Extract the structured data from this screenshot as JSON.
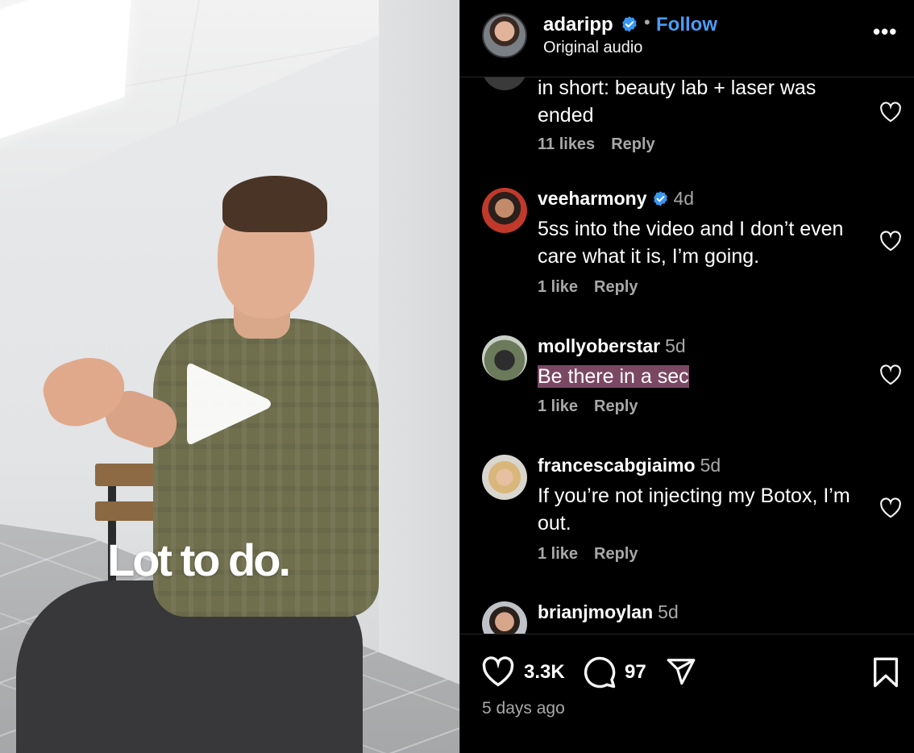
{
  "video": {
    "caption": "Lot to do.",
    "play_icon": "play-icon"
  },
  "header": {
    "username": "adaripp",
    "verified": true,
    "separator": "•",
    "follow_label": "Follow",
    "audio": "Original audio",
    "more_icon": "more-icon",
    "more_label": "•••"
  },
  "comments": [
    {
      "username": "",
      "time": "",
      "text": "in short: beauty lab + laser was ended",
      "likes": "11 likes",
      "reply": "Reply"
    },
    {
      "username": "veeharmony",
      "verified": true,
      "time": "4d",
      "text": "5ss into the video and I don’t even care what it is, I’m going.",
      "likes": "1 like",
      "reply": "Reply"
    },
    {
      "username": "mollyoberstar",
      "time": "5d",
      "text": "Be there in a sec",
      "highlighted": true,
      "likes": "1 like",
      "reply": "Reply"
    },
    {
      "username": "francescabgiaimo",
      "time": "5d",
      "text": "If you’re not injecting my Botox, I’m out.",
      "likes": "1 like",
      "reply": "Reply"
    },
    {
      "username": "brianjmoylan",
      "time": "5d",
      "text": "",
      "likes": "",
      "reply": ""
    }
  ],
  "footer": {
    "like_count": "3.3K",
    "comment_count": "97",
    "posted": "5 days ago"
  },
  "colors": {
    "background": "#000000",
    "link_blue": "#4a9cf5",
    "verified_blue": "#3897f0",
    "secondary_text": "#a8a8a8",
    "highlight": "#7b4863"
  }
}
